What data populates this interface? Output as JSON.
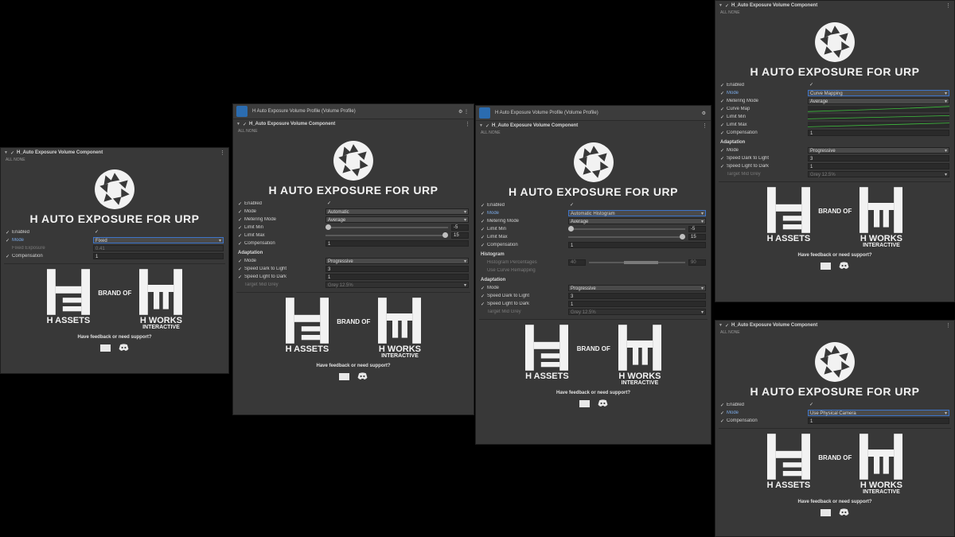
{
  "common": {
    "component_title": "H_Auto Exposure Volume Component",
    "profile_title": "H Auto Exposure Volume Profile (Volume Profile)",
    "all_none": "ALL   NONE",
    "brand_title": "H AUTO EXPOSURE FOR URP",
    "h_assets": "H ASSETS",
    "brand_of": "BRAND OF",
    "h_works": "H WORKS",
    "interactive": "INTERACTIVE",
    "feedback": "Have feedback or need support?",
    "check": "✓",
    "icons": {
      "mail": "mail-icon",
      "discord": "discord-icon"
    }
  },
  "panel1": {
    "rows": [
      {
        "label": "Enabled",
        "value": "✓"
      },
      {
        "label": "Mode",
        "value": "Fixed"
      },
      {
        "label": "Fixed Exposure",
        "value": "0.41"
      },
      {
        "label": "Compensation",
        "value": "1"
      }
    ]
  },
  "panel2": {
    "rows": [
      {
        "label": "Enabled",
        "value": "✓"
      },
      {
        "label": "Mode",
        "value": "Automatic"
      },
      {
        "label": "Metering Mode",
        "value": "Average"
      },
      {
        "label": "Limit Min",
        "value": "-5"
      },
      {
        "label": "Limit Max",
        "value": "15"
      },
      {
        "label": "Compensation",
        "value": "1"
      }
    ],
    "adaptation_label": "Adaptation",
    "adapt_rows": [
      {
        "label": "Mode",
        "value": "Progressive"
      },
      {
        "label": "Speed Dark to Light",
        "value": "3"
      },
      {
        "label": "Speed Light to Dark",
        "value": "1"
      },
      {
        "label": "Target Mid Grey",
        "value": "Grey 12.5%"
      }
    ]
  },
  "panel3": {
    "rows": [
      {
        "label": "Enabled",
        "value": "✓"
      },
      {
        "label": "Mode",
        "value": "Automatic Histogram"
      },
      {
        "label": "Metering Mode",
        "value": "Average"
      },
      {
        "label": "Limit Min",
        "value": "-5"
      },
      {
        "label": "Limit Max",
        "value": "15"
      },
      {
        "label": "Compensation",
        "value": "1"
      }
    ],
    "histogram_label": "Histogram",
    "hist_rows": [
      {
        "label": "Histogram Percentages",
        "min": "40",
        "max": "90"
      },
      {
        "label": "Use Curve Remapping",
        "value": ""
      }
    ],
    "adaptation_label": "Adaptation",
    "adapt_rows": [
      {
        "label": "Mode",
        "value": "Progressive"
      },
      {
        "label": "Speed Dark to Light",
        "value": "3"
      },
      {
        "label": "Speed Light to Dark",
        "value": "1"
      },
      {
        "label": "Target Mid Grey",
        "value": "Grey 12.5%"
      }
    ]
  },
  "panel4": {
    "rows": [
      {
        "label": "Enabled",
        "value": "✓"
      },
      {
        "label": "Mode",
        "value": "Curve Mapping"
      },
      {
        "label": "Metering Mode",
        "value": "Average"
      },
      {
        "label": "Curve Map",
        "value": ""
      },
      {
        "label": "Limit Min",
        "value": ""
      },
      {
        "label": "Limit Max",
        "value": ""
      },
      {
        "label": "Compensation",
        "value": "1"
      }
    ],
    "adaptation_label": "Adaptation",
    "adapt_rows": [
      {
        "label": "Mode",
        "value": "Progressive"
      },
      {
        "label": "Speed Dark to Light",
        "value": "3"
      },
      {
        "label": "Speed Light to Dark",
        "value": "1"
      },
      {
        "label": "Target Mid Grey",
        "value": "Grey 12.5%"
      }
    ],
    "curve_color": "#3fbf3f"
  },
  "panel5": {
    "rows": [
      {
        "label": "Enabled",
        "value": "✓"
      },
      {
        "label": "Mode",
        "value": "Use Physical Camera"
      },
      {
        "label": "Compensation",
        "value": "1"
      }
    ]
  }
}
